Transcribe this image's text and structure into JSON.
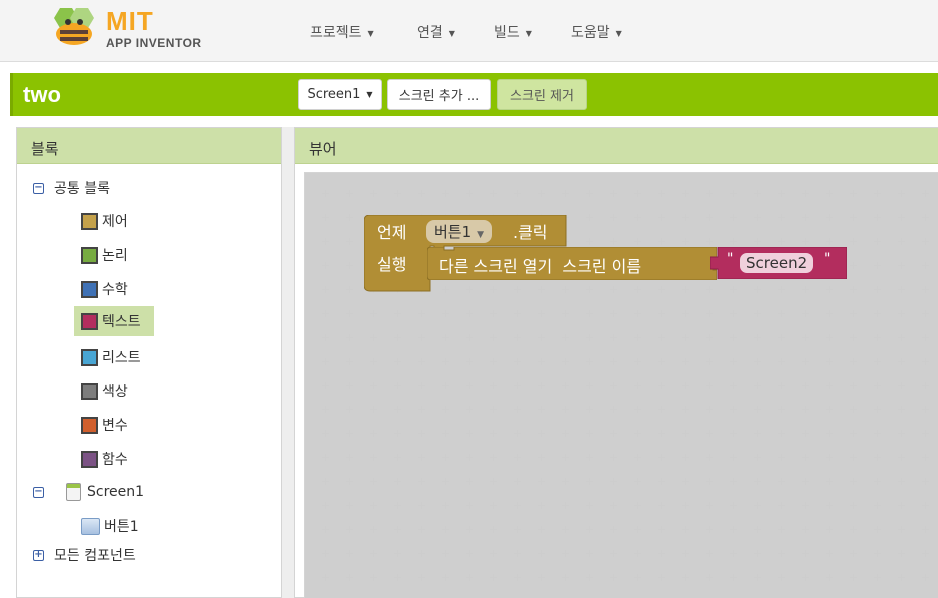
{
  "app": {
    "logo_main": "MIT",
    "logo_sub": "APP INVENTOR"
  },
  "menu": [
    {
      "label": "프로젝트"
    },
    {
      "label": "연결"
    },
    {
      "label": "빌드"
    },
    {
      "label": "도움말"
    }
  ],
  "project": {
    "name": "two",
    "screen_select": "Screen1",
    "add_screen": "스크린 추가 ...",
    "remove_screen": "스크린 제거"
  },
  "blocks_panel": {
    "title": "블록",
    "builtin_label": "공통 블록",
    "builtin": [
      {
        "label": "제어",
        "color": "#c4a14a"
      },
      {
        "label": "논리",
        "color": "#77ab41"
      },
      {
        "label": "수학",
        "color": "#3f71b5"
      },
      {
        "label": "텍스트",
        "color": "#b32d5e"
      },
      {
        "label": "리스트",
        "color": "#49a6d4"
      },
      {
        "label": "색상",
        "color": "#7d7d7d"
      },
      {
        "label": "변수",
        "color": "#d05f2d"
      },
      {
        "label": "함수",
        "color": "#7c5385"
      }
    ],
    "screen_label": "Screen1",
    "component_label": "버튼1",
    "all_components": "모든 컴포넌트"
  },
  "viewer": {
    "title": "뷰어",
    "event_when": "언제",
    "event_component": "버튼1",
    "event_name": ".클릭",
    "event_do": "실행",
    "call_label": "다른 스크린 열기  스크린 이름",
    "string_quote_open": "\"",
    "string_value": "Screen2",
    "string_quote_close": "\"",
    "colors": {
      "event": "#b18e35",
      "text_block": "#b32d5e"
    }
  }
}
